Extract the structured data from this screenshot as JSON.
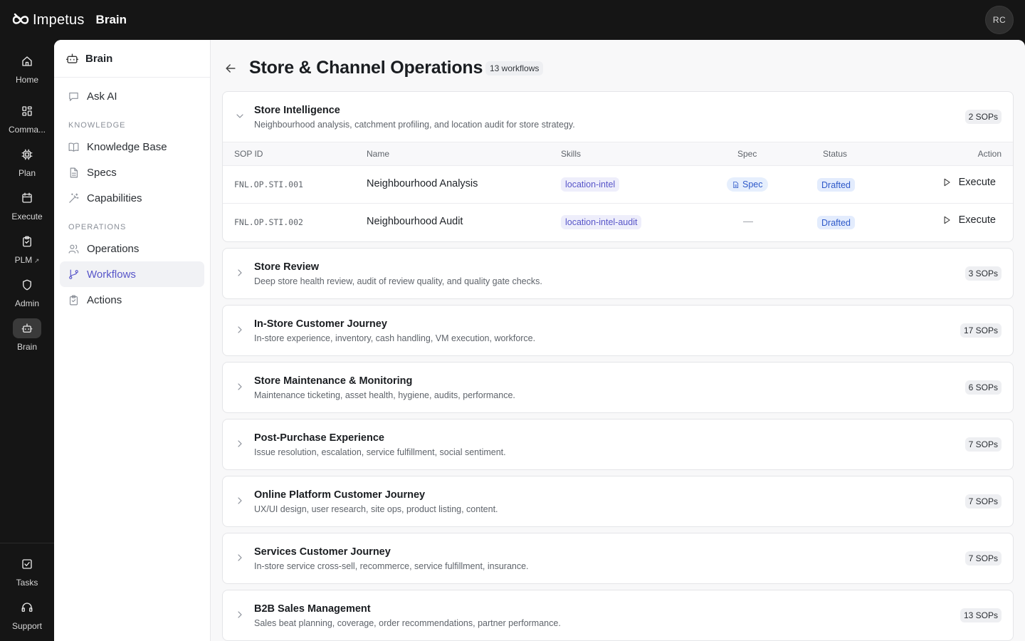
{
  "app": {
    "brand": "Impetus",
    "product": "Brain",
    "user_initials": "RC"
  },
  "rail": {
    "items": [
      {
        "label": "Home",
        "icon": "home-icon"
      },
      {
        "label": "Comma...",
        "icon": "grid-icon"
      },
      {
        "label": "Plan",
        "icon": "chip-icon"
      },
      {
        "label": "Execute",
        "icon": "calendar-icon"
      },
      {
        "label": "PLM",
        "icon": "clipboard-icon",
        "external": true
      },
      {
        "label": "Admin",
        "icon": "shield-icon"
      },
      {
        "label": "Brain",
        "icon": "robot-icon",
        "active": true
      }
    ],
    "bottom": [
      {
        "label": "Tasks",
        "icon": "checkbox-icon"
      },
      {
        "label": "Support",
        "icon": "headset-icon"
      }
    ]
  },
  "sidebar": {
    "title": "Brain",
    "ask_ai": "Ask AI",
    "knowledge_section": "KNOWLEDGE",
    "knowledge_items": [
      "Knowledge Base",
      "Specs",
      "Capabilities"
    ],
    "operations_section": "OPERATIONS",
    "operations_items": [
      "Operations",
      "Workflows",
      "Actions"
    ],
    "active": "Workflows"
  },
  "page": {
    "title": "Store & Channel Operations",
    "count": "13 workflows"
  },
  "table": {
    "headers": {
      "sop_id": "SOP ID",
      "name": "Name",
      "skills": "Skills",
      "spec": "Spec",
      "status": "Status",
      "action": "Action"
    }
  },
  "workflows": [
    {
      "title": "Store Intelligence",
      "desc": "Neighbourhood analysis, catchment profiling, and location audit for store strategy.",
      "sops": "2 SOPs",
      "expanded": true,
      "rows": [
        {
          "id": "FNL.OP.STI.001",
          "name": "Neighbourhood Analysis",
          "skill": "location-intel",
          "spec": "Spec",
          "status": "Drafted",
          "action": "Execute"
        },
        {
          "id": "FNL.OP.STI.002",
          "name": "Neighbourhood Audit",
          "skill": "location-intel-audit",
          "spec": "—",
          "status": "Drafted",
          "action": "Execute"
        }
      ]
    },
    {
      "title": "Store Review",
      "desc": "Deep store health review, audit of review quality, and quality gate checks.",
      "sops": "3 SOPs"
    },
    {
      "title": "In-Store Customer Journey",
      "desc": "In-store experience, inventory, cash handling, VM execution, workforce.",
      "sops": "17 SOPs"
    },
    {
      "title": "Store Maintenance & Monitoring",
      "desc": "Maintenance ticketing, asset health, hygiene, audits, performance.",
      "sops": "6 SOPs"
    },
    {
      "title": "Post-Purchase Experience",
      "desc": "Issue resolution, escalation, service fulfillment, social sentiment.",
      "sops": "7 SOPs"
    },
    {
      "title": "Online Platform Customer Journey",
      "desc": "UX/UI design, user research, site ops, product listing, content.",
      "sops": "7 SOPs"
    },
    {
      "title": "Services Customer Journey",
      "desc": "In-store service cross-sell, recommerce, service fulfillment, insurance.",
      "sops": "7 SOPs"
    },
    {
      "title": "B2B Sales Management",
      "desc": "Sales beat planning, coverage, order recommendations, partner performance.",
      "sops": "13 SOPs"
    }
  ]
}
